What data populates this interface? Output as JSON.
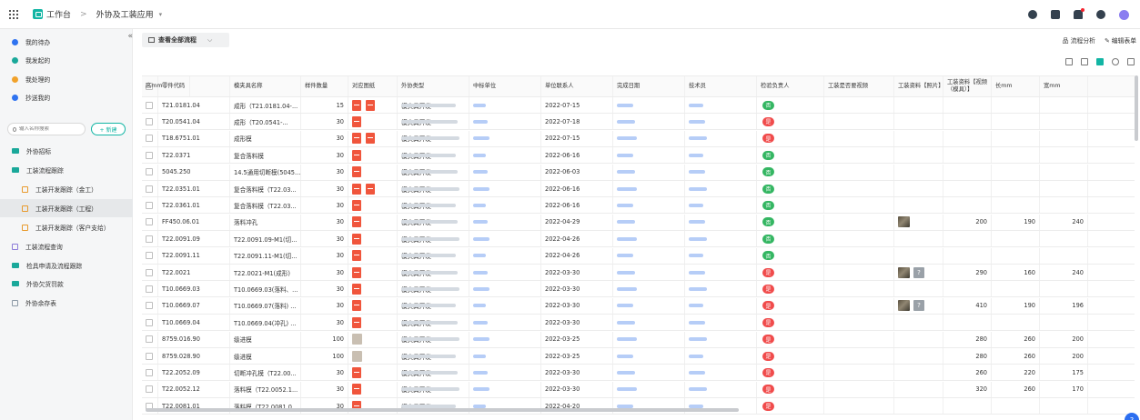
{
  "header": {
    "app_label": "工作台",
    "separator": ">",
    "current_app": "外协及工装应用",
    "dropdown_caret": "▾"
  },
  "sidebar": {
    "collapse_glyph": "«",
    "items": [
      {
        "label": "我的待办",
        "icon": "bell-icon",
        "color": "#2f73f0"
      },
      {
        "label": "我发起的",
        "icon": "play-icon",
        "color": "#1aa89a"
      },
      {
        "label": "我处理的",
        "icon": "stamp-icon",
        "color": "#f1a22b"
      },
      {
        "label": "抄送我的",
        "icon": "send-icon",
        "color": "#2f73f0"
      }
    ],
    "search_placeholder": "输入名称搜索",
    "new_button": "+ 新建",
    "nav": [
      {
        "label": "外协招标",
        "icon": "folder-icon",
        "sub": false
      },
      {
        "label": "工装流程跟踪",
        "icon": "folder-icon",
        "sub": false
      },
      {
        "label": "工装开发跟踪（金工）",
        "icon": "form-icon",
        "sub": true
      },
      {
        "label": "工装开发跟踪（工程）",
        "icon": "form-icon",
        "sub": true,
        "active": true
      },
      {
        "label": "工装开发跟踪（客户支给）",
        "icon": "form-icon",
        "sub": true
      },
      {
        "label": "工装流程查询",
        "icon": "report-icon",
        "sub": false
      },
      {
        "label": "检具申请及流程跟踪",
        "icon": "folder-icon",
        "sub": false
      },
      {
        "label": "外协欠货罚款",
        "icon": "folder-icon",
        "sub": false
      },
      {
        "label": "外协余存表",
        "icon": "table-icon",
        "sub": false
      }
    ]
  },
  "toolbar": {
    "view_label": "查看全部流程",
    "view_caret": "⌵",
    "flow_analysis": "品 流程分析",
    "edit_form": "✎ 编辑表单"
  },
  "table": {
    "columns": [
      "零件代码",
      "模夹具名称",
      "样件数量",
      "对应图纸",
      "外协类型",
      "中标单位",
      "单位联系人",
      "完成日期",
      "技术员",
      "检验负责人",
      "工装是否要视频",
      "工装资料【照片】",
      "工装资料【视频（模具）】",
      "长mm",
      "宽mm",
      "高mm"
    ],
    "rows": [
      {
        "code": "T21.0181.04",
        "name": "成形（T21.0181.04-...",
        "qty": "15",
        "pdfs": 2,
        "thumb": false,
        "type": "模夹具开发",
        "date": "2022-07-15",
        "video": "否",
        "photos": "",
        "len": "",
        "wid": "",
        "hei": ""
      },
      {
        "code": "T20.0541.04",
        "name": "成形（T20.0541-...",
        "qty": "30",
        "pdfs": 1,
        "thumb": false,
        "type": "模夹具开发",
        "date": "2022-07-18",
        "video": "是",
        "photos": "",
        "len": "",
        "wid": "",
        "hei": ""
      },
      {
        "code": "T18.6751.01",
        "name": "成形模",
        "qty": "30",
        "pdfs": 2,
        "thumb": false,
        "type": "模夹具开发",
        "date": "2022-07-15",
        "video": "是",
        "photos": "",
        "len": "",
        "wid": "",
        "hei": ""
      },
      {
        "code": "T22.0371",
        "name": "复合落料模",
        "qty": "30",
        "pdfs": 1,
        "thumb": false,
        "type": "模夹具开发",
        "date": "2022-06-16",
        "video": "否",
        "photos": "",
        "len": "",
        "wid": "",
        "hei": ""
      },
      {
        "code": "5045.250",
        "name": "14.5通用切断模(5045....",
        "qty": "30",
        "pdfs": 1,
        "thumb": false,
        "type": "模夹具开发",
        "date": "2022-06-03",
        "video": "否",
        "photos": "",
        "len": "",
        "wid": "",
        "hei": ""
      },
      {
        "code": "T22.0351.01",
        "name": "复合落料模（T22.03...",
        "qty": "30",
        "pdfs": 2,
        "thumb": false,
        "type": "模夹具开发",
        "date": "2022-06-16",
        "video": "否",
        "photos": "",
        "len": "",
        "wid": "",
        "hei": ""
      },
      {
        "code": "T22.0361.01",
        "name": "复合落料模（T22.03...",
        "qty": "30",
        "pdfs": 1,
        "thumb": false,
        "type": "模夹具开发",
        "date": "2022-06-16",
        "video": "否",
        "photos": "",
        "len": "",
        "wid": "",
        "hei": ""
      },
      {
        "code": "FF450.06.01",
        "name": "落料冲孔",
        "qty": "30",
        "pdfs": 1,
        "thumb": false,
        "type": "模夹具开发",
        "date": "2022-04-29",
        "video": "否",
        "photos": "photo",
        "len": "200",
        "wid": "190",
        "hei": "240"
      },
      {
        "code": "T22.0091.09",
        "name": "T22.0091.09-M1(切...",
        "qty": "30",
        "pdfs": 1,
        "thumb": false,
        "type": "模夹具开发",
        "date": "2022-04-26",
        "video": "否",
        "photos": "",
        "len": "",
        "wid": "",
        "hei": ""
      },
      {
        "code": "T22.0091.11",
        "name": "T22.0091.11-M1(切...",
        "qty": "30",
        "pdfs": 1,
        "thumb": false,
        "type": "模夹具开发",
        "date": "2022-04-26",
        "video": "否",
        "photos": "",
        "len": "",
        "wid": "",
        "hei": ""
      },
      {
        "code": "T22.0021",
        "name": "T22.0021-M1(成形)",
        "qty": "30",
        "pdfs": 1,
        "thumb": false,
        "type": "模夹具开发",
        "date": "2022-03-30",
        "video": "是",
        "photos": "photo+q",
        "len": "290",
        "wid": "160",
        "hei": "240"
      },
      {
        "code": "T10.0669.03",
        "name": "T10.0669.03(落料、...",
        "qty": "30",
        "pdfs": 1,
        "thumb": false,
        "type": "模夹具开发",
        "date": "2022-03-30",
        "video": "是",
        "photos": "",
        "len": "",
        "wid": "",
        "hei": ""
      },
      {
        "code": "T10.0669.07",
        "name": "T10.0669.07(落料) ...",
        "qty": "30",
        "pdfs": 1,
        "thumb": false,
        "type": "模夹具开发",
        "date": "2022-03-30",
        "video": "是",
        "photos": "photo+q",
        "len": "410",
        "wid": "190",
        "hei": "196"
      },
      {
        "code": "T10.0669.04",
        "name": "T10.0669.04(冲孔) ...",
        "qty": "30",
        "pdfs": 1,
        "thumb": false,
        "type": "模夹具开发",
        "date": "2022-03-30",
        "video": "是",
        "photos": "",
        "len": "",
        "wid": "",
        "hei": ""
      },
      {
        "code": "8759.016.90",
        "name": "级进模",
        "qty": "100",
        "pdfs": 0,
        "thumb": true,
        "type": "模夹具开发",
        "date": "2022-03-25",
        "video": "是",
        "photos": "",
        "len": "280",
        "wid": "260",
        "hei": "200"
      },
      {
        "code": "8759.028.90",
        "name": "级进模",
        "qty": "100",
        "pdfs": 0,
        "thumb": true,
        "type": "模夹具开发",
        "date": "2022-03-25",
        "video": "是",
        "photos": "",
        "len": "280",
        "wid": "260",
        "hei": "200"
      },
      {
        "code": "T22.2052.09",
        "name": "切断冲孔模（T22.00...",
        "qty": "30",
        "pdfs": 1,
        "thumb": false,
        "type": "模夹具开发",
        "date": "2022-03-30",
        "video": "是",
        "photos": "",
        "len": "260",
        "wid": "220",
        "hei": "175"
      },
      {
        "code": "T22.0052.12",
        "name": "落料模（T22.0052.1...",
        "qty": "30",
        "pdfs": 1,
        "thumb": false,
        "type": "模夹具开发",
        "date": "2022-03-30",
        "video": "是",
        "photos": "",
        "len": "320",
        "wid": "260",
        "hei": "170"
      },
      {
        "code": "T22.0081.01",
        "name": "落料模（T22.0081.0...",
        "qty": "30",
        "pdfs": 1,
        "thumb": false,
        "type": "模夹具开发",
        "date": "2022-04-20",
        "video": "是",
        "photos": "",
        "len": "",
        "wid": "",
        "hei": ""
      }
    ]
  },
  "help_glyph": "?",
  "colors": {
    "accent": "#12b5a4",
    "yes": "#f04b4b",
    "no": "#34b662",
    "pdf": "#f0553c"
  }
}
